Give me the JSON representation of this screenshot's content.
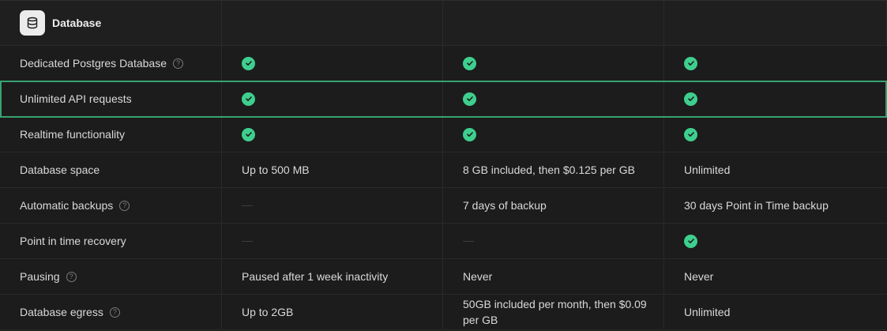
{
  "section": {
    "title": "Database",
    "icon": "database-icon"
  },
  "rows": [
    {
      "feature": "Dedicated Postgres Database",
      "help": true,
      "free": "check",
      "pro": "check",
      "team": "check"
    },
    {
      "feature": "Unlimited API requests",
      "help": false,
      "free": "check",
      "pro": "check",
      "team": "check"
    },
    {
      "feature": "Realtime functionality",
      "help": false,
      "free": "check",
      "pro": "check",
      "team": "check"
    },
    {
      "feature": "Database space",
      "help": false,
      "free": "Up to 500 MB",
      "pro": "8 GB included, then $0.125 per GB",
      "team": "Unlimited"
    },
    {
      "feature": "Automatic backups",
      "help": true,
      "free": "dash",
      "pro": "7 days of backup",
      "team": "30 days Point in Time backup"
    },
    {
      "feature": "Point in time recovery",
      "help": false,
      "free": "dash",
      "pro": "dash",
      "team": "check"
    },
    {
      "feature": "Pausing",
      "help": true,
      "free": "Paused after 1 week inactivity",
      "pro": "Never",
      "team": "Never"
    },
    {
      "feature": "Database egress",
      "help": true,
      "free": "Up to 2GB",
      "pro": "50GB included per month, then $0.09 per GB",
      "team": "Unlimited"
    }
  ],
  "colors": {
    "accent": "#3ecf8e",
    "background": "#1c1c1c"
  }
}
